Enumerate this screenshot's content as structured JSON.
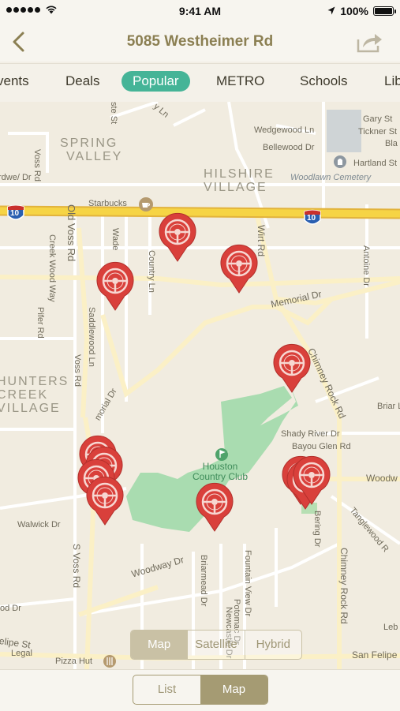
{
  "status": {
    "time": "9:41 AM",
    "battery": "100%",
    "battery_level": 1.0
  },
  "nav": {
    "title": "5085 Westheimer Rd",
    "back_icon": "chevron-left-icon",
    "share_icon": "share-icon"
  },
  "tabs": [
    {
      "label": "Events",
      "visible": "vents",
      "active": false
    },
    {
      "label": "Deals",
      "active": false
    },
    {
      "label": "Popular",
      "active": true
    },
    {
      "label": "METRO",
      "active": false
    },
    {
      "label": "Schools",
      "active": false
    },
    {
      "label": "Libraries",
      "visible": "Lib",
      "active": false
    }
  ],
  "map": {
    "areas": [
      "SPRING VALLEY",
      "HILSHIRE VILLAGE",
      "HUNTERS CREEK VILLAGE"
    ],
    "area_lines": {
      "spring": [
        "SPRING",
        "VALLEY"
      ],
      "hilshire": [
        "HILSHIRE",
        "VILLAGE"
      ],
      "hunters": [
        "HUNTERS",
        "CREEK",
        "VILLAGE"
      ]
    },
    "poi": {
      "starbucks": "Starbucks",
      "cemetery": "Woodlawn Cemetery",
      "club": "Houston Country Club",
      "club_lines": [
        "Houston",
        "Country Club"
      ],
      "pizza": "Pizza Hut",
      "legal": "Legal"
    },
    "interstate": "10",
    "streets": {
      "wedgewood": "Wedgewood Ln",
      "bellewood": "Bellewood Dr",
      "gary": "Gary St",
      "tickner": "Tickner St",
      "blalock": "Bla",
      "hartland": "Hartland St",
      "rdwe": "rdwe/ Dr",
      "voss_rd": "Voss Rd",
      "old_voss": "Old Voss Rd",
      "creek_wood": "Creek Wood Way",
      "wade": "Wade",
      "country_ln": "Country Ln",
      "city_ln": "y Ln",
      "wirt": "Wirt Rd",
      "antoine": "Antoine Dr",
      "memorial": "Memorial Dr",
      "saddlewood": "Saddlewood Ln",
      "piferd": "Pifer Rd",
      "voss_rd2": "Voss Rd",
      "chimney1": "Chimney Rock Rd",
      "briar": "Briar L",
      "shady": "Shady River Dr",
      "bayou": "Bayou Glen Rd",
      "woodw": "Woodw",
      "tanglewood": "Tanglewood R",
      "bering": "Bering Dr",
      "walwick": "Walwick Dr",
      "s_voss": "S Voss Rd",
      "woodway": "Woodway Dr",
      "briarmead": "Briarmead Dr",
      "fountain": "Fountain View Dr",
      "potomac": "Potomac Dr",
      "newcastle": "Newcastle Dr",
      "chimney2": "Chimney Rock Rd",
      "od_dr": "od Dr",
      "elipe": "elipe St",
      "san_felipe": "San Felipe",
      "leb": "Leb",
      "morial": "morial Dr",
      "ste": "ste St"
    },
    "pins": {
      "count": 12,
      "icon": "steering-wheel-pin-icon",
      "color": "#d9403b"
    }
  },
  "map_type": {
    "options": [
      "Map",
      "Satellite",
      "Hybrid"
    ],
    "selected": "Map"
  },
  "view_toggle": {
    "options": [
      "List",
      "Map"
    ],
    "selected": "Map"
  }
}
